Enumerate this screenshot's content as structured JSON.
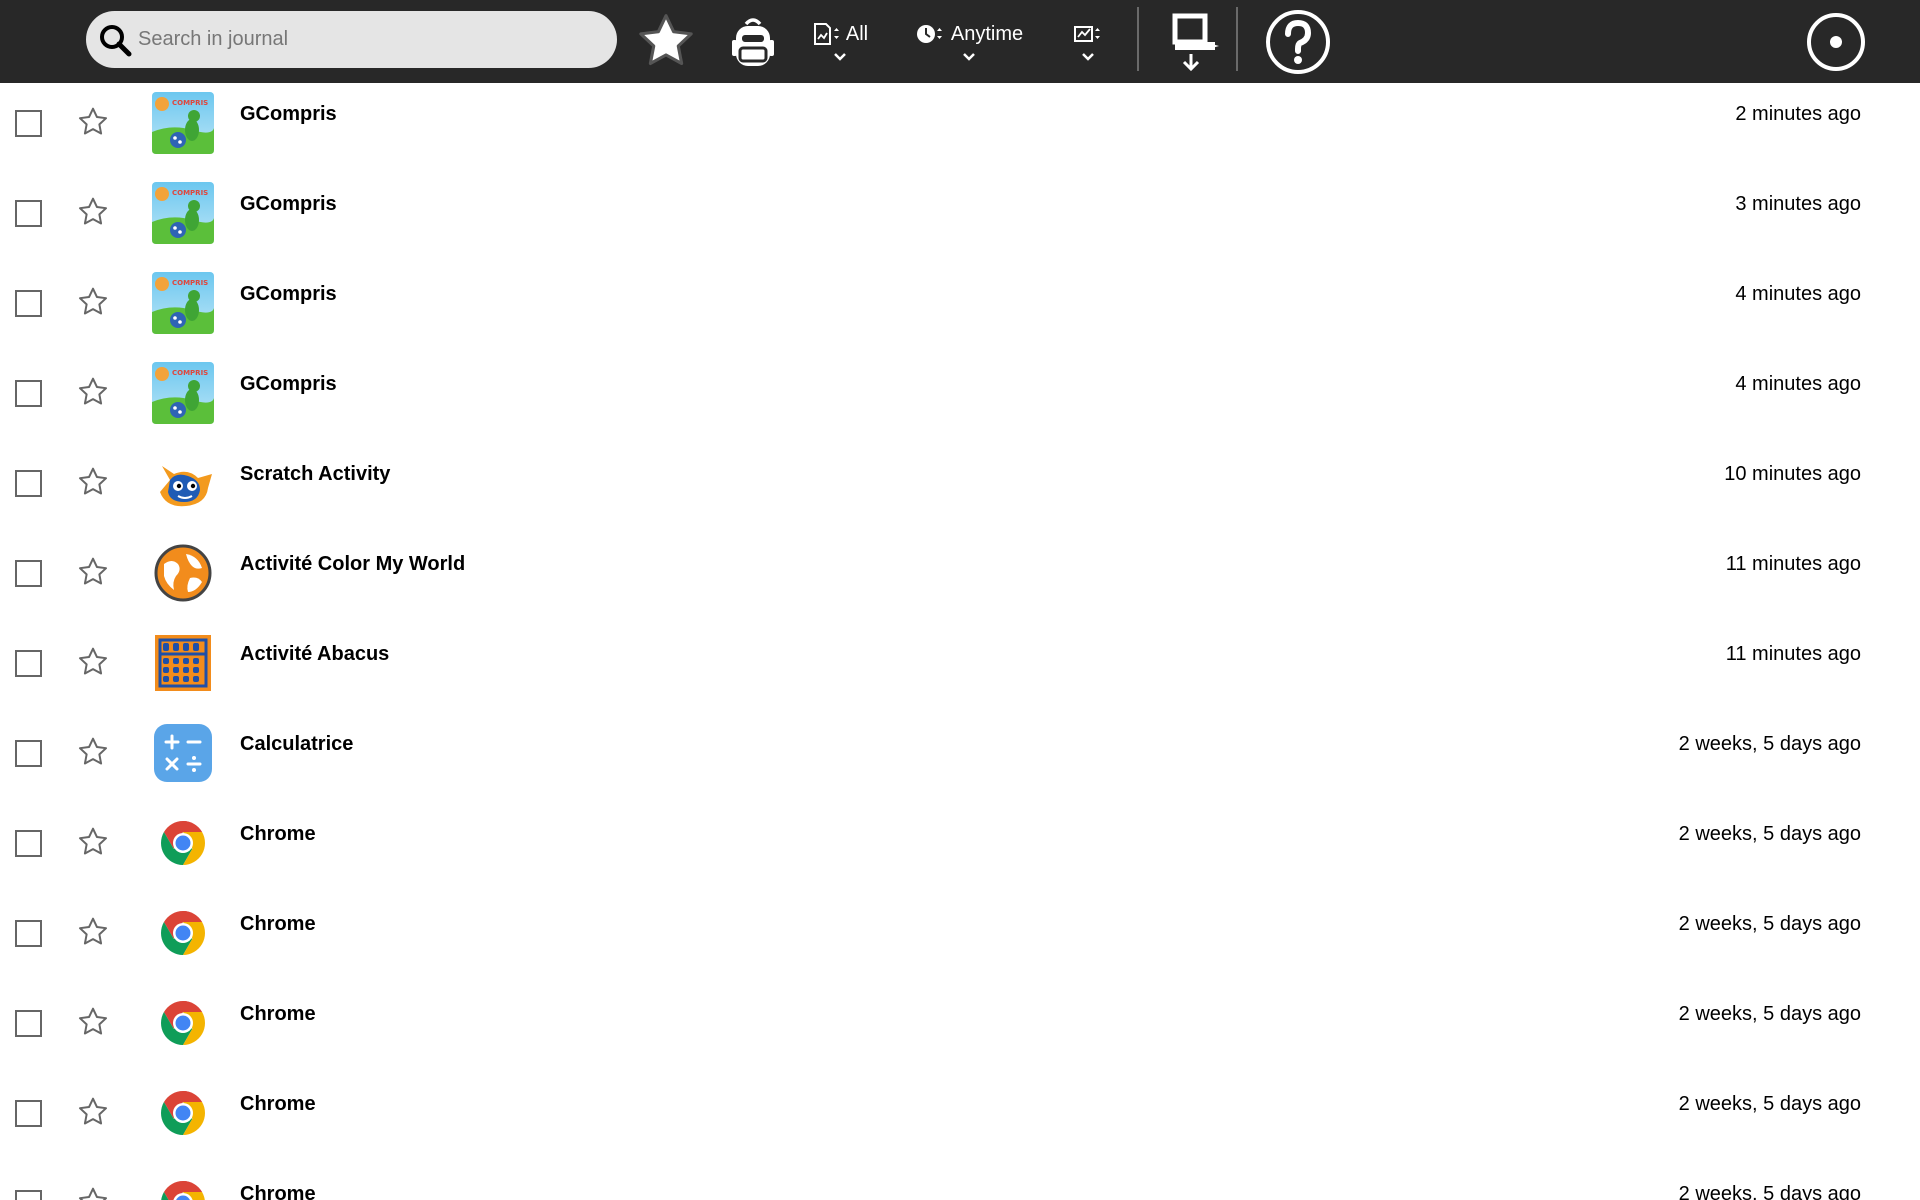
{
  "toolbar": {
    "search_placeholder": "Search in journal",
    "type_filter_label": "All",
    "time_filter_label": "Anytime"
  },
  "colors": {
    "toolbar_bg": "#282828",
    "search_bg": "#e5e5e5",
    "accent_blue": "#1e5fb8",
    "accent_orange": "#f28c1c"
  },
  "items": [
    {
      "title": "GCompris",
      "time": "2 minutes ago",
      "icon": "gcompris-icon"
    },
    {
      "title": "GCompris",
      "time": "3 minutes ago",
      "icon": "gcompris-icon"
    },
    {
      "title": "GCompris",
      "time": "4 minutes ago",
      "icon": "gcompris-icon"
    },
    {
      "title": "GCompris",
      "time": "4 minutes ago",
      "icon": "gcompris-icon"
    },
    {
      "title": "Scratch Activity",
      "time": "10 minutes ago",
      "icon": "scratch-cat-icon"
    },
    {
      "title": "Activité Color My World",
      "time": "11 minutes ago",
      "icon": "globe-icon"
    },
    {
      "title": "Activité Abacus",
      "time": "11 minutes ago",
      "icon": "abacus-icon"
    },
    {
      "title": "Calculatrice",
      "time": "2 weeks, 5 days ago",
      "icon": "calculator-icon"
    },
    {
      "title": "Chrome",
      "time": "2 weeks, 5 days ago",
      "icon": "chrome-icon"
    },
    {
      "title": "Chrome",
      "time": "2 weeks, 5 days ago",
      "icon": "chrome-icon"
    },
    {
      "title": "Chrome",
      "time": "2 weeks, 5 days ago",
      "icon": "chrome-icon"
    },
    {
      "title": "Chrome",
      "time": "2 weeks, 5 days ago",
      "icon": "chrome-icon"
    },
    {
      "title": "Chrome",
      "time": "2 weeks, 5 days ago",
      "icon": "chrome-icon"
    }
  ]
}
